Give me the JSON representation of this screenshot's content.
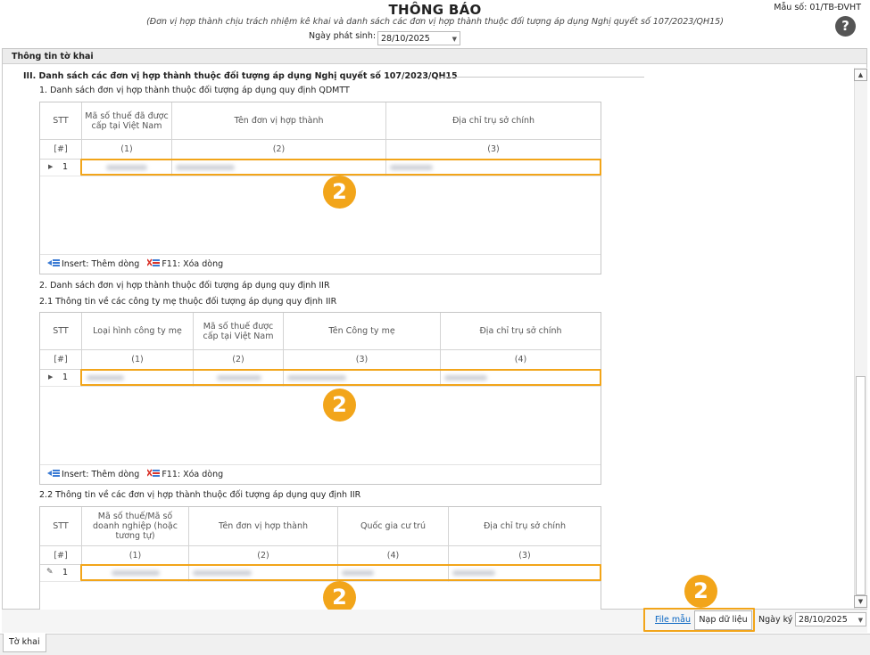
{
  "header": {
    "title": "THÔNG BÁO",
    "subtitle": "(Đơn vị hợp thành chịu trách nhiệm kê khai và danh sách các đơn vị hợp thành thuộc đối tượng áp dụng Nghị quyết số 107/2023/QH15)",
    "form_code": "Mẫu số: 01/TB-ĐVHT",
    "help_symbol": "?",
    "issue_date_label": "Ngày phát sinh:",
    "issue_date_value": "28/10/2025"
  },
  "section_header": "Thông tin tờ khai",
  "section3_title": "III. Danh sách các đơn vị hợp thành thuộc đối tượng áp dụng Nghị quyết số 107/2023/QH15",
  "table1": {
    "caption": "1. Danh sách đơn vị hợp thành thuộc đối tượng áp dụng quy định QDMTT",
    "headers": [
      "STT",
      "Mã số thuế đã được cấp tại Việt Nam",
      "Tên đơn vị hợp thành",
      "Địa chỉ trụ sở chính"
    ],
    "codes": [
      "[#]",
      "(1)",
      "(2)",
      "(3)"
    ],
    "row_number": "1"
  },
  "section2_caption": "2. Danh sách đơn vị hợp thành thuộc đối tượng áp dụng quy định IIR",
  "table2": {
    "caption": "2.1 Thông tin về các công ty mẹ thuộc đối tượng áp dụng quy định IIR",
    "headers": [
      "STT",
      "Loại hình công ty mẹ",
      "Mã số thuế được cấp tại Việt Nam",
      "Tên Công ty mẹ",
      "Địa chỉ trụ sở chính"
    ],
    "codes": [
      "[#]",
      "(1)",
      "(2)",
      "(3)",
      "(4)"
    ],
    "row_number": "1"
  },
  "table3": {
    "caption": "2.2 Thông tin về các đơn vị hợp thành thuộc đối tượng áp dụng quy định IIR",
    "headers": [
      "STT",
      "Mã số thuế/Mã số doanh nghiệp (hoặc tương tự)",
      "Tên đơn vị hợp thành",
      "Quốc gia cư trú",
      "Địa chỉ trụ sở chính"
    ],
    "codes": [
      "[#]",
      "(1)",
      "(2)",
      "(4)",
      "(3)"
    ],
    "row_number": "1"
  },
  "toolbar": {
    "insert_label": "Insert: Thêm dòng",
    "delete_label": "F11: Xóa dòng"
  },
  "badge_text": "2",
  "footer": {
    "file_mau_label": "File mẫu",
    "load_data_label": "Nạp dữ liệu",
    "sign_date_label": "Ngày ký",
    "sign_date_value": "28/10/2025"
  },
  "tab_label": "Tờ khai",
  "colors": {
    "highlight": "#f2a51a",
    "link": "#0a66c2"
  }
}
